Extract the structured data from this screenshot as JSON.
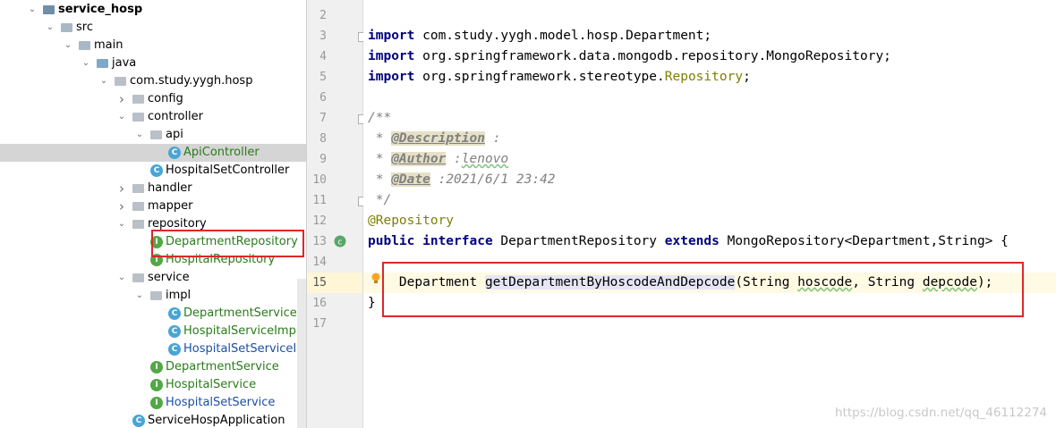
{
  "tree": {
    "items": [
      {
        "label": "service_hosp",
        "depth": 0,
        "arrow": "down",
        "icon": "root",
        "style": "bold",
        "name": "tree-item-service-hosp"
      },
      {
        "label": "src",
        "depth": 1,
        "arrow": "down",
        "icon": "folder",
        "style": "",
        "name": "tree-item-src"
      },
      {
        "label": "main",
        "depth": 2,
        "arrow": "down",
        "icon": "folder",
        "style": "",
        "name": "tree-item-main"
      },
      {
        "label": "java",
        "depth": 3,
        "arrow": "down",
        "icon": "src",
        "style": "",
        "name": "tree-item-java"
      },
      {
        "label": "com.study.yygh.hosp",
        "depth": 4,
        "arrow": "down",
        "icon": "pkg",
        "style": "",
        "name": "tree-item-com-study-yygh-hosp"
      },
      {
        "label": "config",
        "depth": 5,
        "arrow": "right",
        "icon": "pkg",
        "style": "",
        "name": "tree-item-config"
      },
      {
        "label": "controller",
        "depth": 5,
        "arrow": "down",
        "icon": "pkg",
        "style": "",
        "name": "tree-item-controller"
      },
      {
        "label": "api",
        "depth": 6,
        "arrow": "down",
        "icon": "pkg",
        "style": "",
        "name": "tree-item-api"
      },
      {
        "label": "ApiController",
        "depth": 7,
        "arrow": "",
        "icon": "class",
        "style": "green",
        "name": "tree-item-apicontroller",
        "selected": true
      },
      {
        "label": "HospitalSetController",
        "depth": 6,
        "arrow": "",
        "icon": "class",
        "style": "",
        "name": "tree-item-hospitalsetcontroller"
      },
      {
        "label": "handler",
        "depth": 5,
        "arrow": "right",
        "icon": "pkg",
        "style": "",
        "name": "tree-item-handler"
      },
      {
        "label": "mapper",
        "depth": 5,
        "arrow": "right",
        "icon": "pkg",
        "style": "",
        "name": "tree-item-mapper"
      },
      {
        "label": "repository",
        "depth": 5,
        "arrow": "down",
        "icon": "pkg",
        "style": "",
        "name": "tree-item-repository"
      },
      {
        "label": "DepartmentRepository",
        "depth": 6,
        "arrow": "",
        "icon": "interface",
        "style": "green",
        "name": "tree-item-departmentrepository"
      },
      {
        "label": "HospitalRepository",
        "depth": 6,
        "arrow": "",
        "icon": "interface",
        "style": "green",
        "name": "tree-item-hospitalrepository"
      },
      {
        "label": "service",
        "depth": 5,
        "arrow": "down",
        "icon": "pkg",
        "style": "",
        "name": "tree-item-service"
      },
      {
        "label": "impl",
        "depth": 6,
        "arrow": "down",
        "icon": "pkg",
        "style": "",
        "name": "tree-item-impl"
      },
      {
        "label": "DepartmentServiceImpl",
        "depth": 7,
        "arrow": "",
        "icon": "class",
        "style": "green",
        "name": "tree-item-departmentserviceimpl"
      },
      {
        "label": "HospitalServiceImpl",
        "depth": 7,
        "arrow": "",
        "icon": "class",
        "style": "green",
        "name": "tree-item-hospitalserviceimpl"
      },
      {
        "label": "HospitalSetServiceImpl",
        "depth": 7,
        "arrow": "",
        "icon": "class",
        "style": "blue",
        "name": "tree-item-hospitalsetserviceimpl"
      },
      {
        "label": "DepartmentService",
        "depth": 6,
        "arrow": "",
        "icon": "interface",
        "style": "green",
        "name": "tree-item-departmentservice"
      },
      {
        "label": "HospitalService",
        "depth": 6,
        "arrow": "",
        "icon": "interface",
        "style": "green",
        "name": "tree-item-hospitalservice"
      },
      {
        "label": "HospitalSetService",
        "depth": 6,
        "arrow": "",
        "icon": "interface",
        "style": "blue",
        "name": "tree-item-hospitalsetservice"
      },
      {
        "label": "ServiceHospApplication",
        "depth": 5,
        "arrow": "",
        "icon": "app",
        "style": "",
        "name": "tree-item-servicehospapplication"
      }
    ]
  },
  "editor": {
    "lines": [
      {
        "n": "2",
        "html": ""
      },
      {
        "n": "3",
        "html": "<span class=\"kw\">import</span> com.study.yygh.model.hosp.Department;"
      },
      {
        "n": "4",
        "html": "<span class=\"kw\">import</span> org.springframework.data.mongodb.repository.MongoRepository;"
      },
      {
        "n": "5",
        "html": "<span class=\"kw\">import</span> org.springframework.stereotype.<span class=\"ann\">Repository</span>;"
      },
      {
        "n": "6",
        "html": ""
      },
      {
        "n": "7",
        "html": "<span class=\"cm\">/**</span>"
      },
      {
        "n": "8",
        "html": "<span class=\"cm\"> * </span><span class=\"tag\">@Description</span><span class=\"cm\"> :</span>"
      },
      {
        "n": "9",
        "html": "<span class=\"cm\"> * </span><span class=\"tag\">@Author</span><span class=\"cm\"> :<span class=\"typo\">lenovo</span></span>"
      },
      {
        "n": "10",
        "html": "<span class=\"cm\"> * </span><span class=\"tag\">@Date</span><span class=\"cm\"> :2021/6/1 23:42</span>"
      },
      {
        "n": "11",
        "html": "<span class=\"cm\"> */</span>"
      },
      {
        "n": "12",
        "html": "<span class=\"ann\">@Repository</span>"
      },
      {
        "n": "13",
        "html": "<span class=\"kw\">public interface</span> DepartmentRepository <span class=\"kw\">extends</span> MongoRepository&lt;Department,String&gt; {"
      },
      {
        "n": "14",
        "html": ""
      },
      {
        "n": "15",
        "html": "    Department <span class=\"hl\">getDepartmentByHoscodeAndDepcode</span>(String <span class=\"typo\">hoscode</span>, String <span class=\"typo\">depcode</span>);",
        "current": true
      },
      {
        "n": "16",
        "html": "}"
      },
      {
        "n": "17",
        "html": ""
      }
    ]
  },
  "watermark": "https://blog.csdn.net/qq_46112274",
  "colors": {
    "highlight_box": "#e0262a",
    "current_line": "#fffae3",
    "keyword": "#000080"
  }
}
